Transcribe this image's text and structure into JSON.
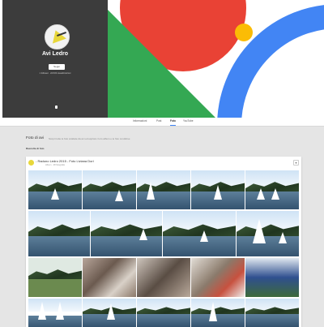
{
  "profile": {
    "name": "Avi Ledro",
    "follow_label": "Segui",
    "meta": "1 follower · 24.533 visualizzazioni"
  },
  "tabs": [
    {
      "label": "Informazioni",
      "active": false
    },
    {
      "label": "Post",
      "active": false
    },
    {
      "label": "Foto",
      "active": true
    },
    {
      "label": "YouTube",
      "active": false
    }
  ],
  "section": {
    "title": "Foto di avi",
    "description": "Scopri tutte le foto scattate da avi ed esplora i loro album e le foto condivise",
    "subheading": "Raccolte di foto"
  },
  "album": {
    "title": "- Raduno Ledro 2015 - Foto Liviana Dori",
    "subtitle": "Album · 28 fotografie",
    "menu_icon": "chevron-down-icon"
  },
  "colors": {
    "profile_bg": "#3c3c3c",
    "red": "#e94235",
    "green": "#34a853",
    "yellow": "#fbbc05",
    "blue": "#4285f4",
    "page_bg": "#e5e5e5"
  }
}
